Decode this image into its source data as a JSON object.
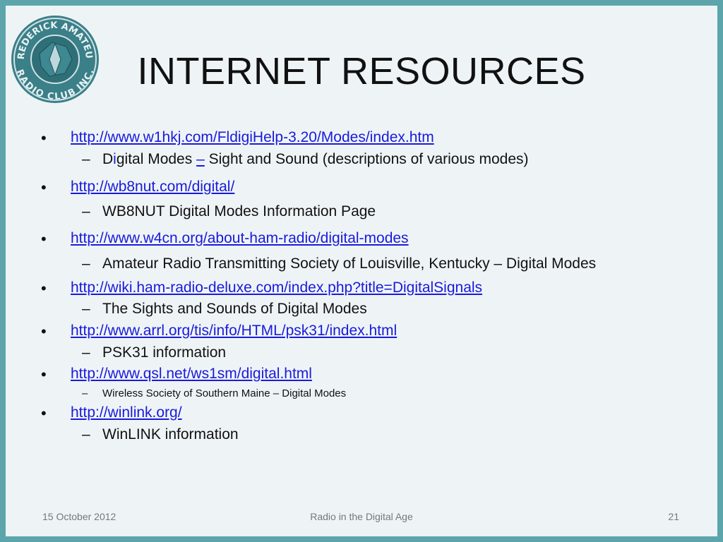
{
  "logo": {
    "text_top": "FREDERICK AMATEUR",
    "text_bottom": "RADIO CLUB INC."
  },
  "title": "INTERNET RESOURCES",
  "items": [
    {
      "link": "http://www.w1hkj.com/FldigiHelp-3.20/Modes/index.htm",
      "sub_parts": [
        "D",
        "i",
        "gital Modes ",
        "–",
        " Sight and Sound (descriptions of various modes)"
      ]
    },
    {
      "link": "http://wb8nut.com/digital/",
      "sub": "WB8NUT Digital Modes Information Page"
    },
    {
      "link": "http://www.w4cn.org/about-ham-radio/digital-modes",
      "sub": "Amateur Radio Transmitting Society of Louisville, Kentucky – Digital Modes"
    },
    {
      "link": "http://wiki.ham-radio-deluxe.com/index.php?title=DigitalSignals",
      "sub": "The Sights and Sounds of Digital Modes"
    },
    {
      "link": "http://www.arrl.org/tis/info/HTML/psk31/index.html",
      "sub": "PSK31 information"
    },
    {
      "link": "http://www.qsl.net/ws1sm/digital.html",
      "sub": "Wireless Society of Southern Maine – Digital Modes"
    },
    {
      "link": "http://winlink.org/",
      "sub": "WinLINK information"
    }
  ],
  "bullet_char": "•",
  "dash_char": "–",
  "footer": {
    "date": "15 October 2012",
    "center": "Radio in the Digital Age",
    "page": "21"
  },
  "colors": {
    "frame": "#5ba5ab",
    "background": "#eef4f6",
    "link": "#1a1adc"
  }
}
